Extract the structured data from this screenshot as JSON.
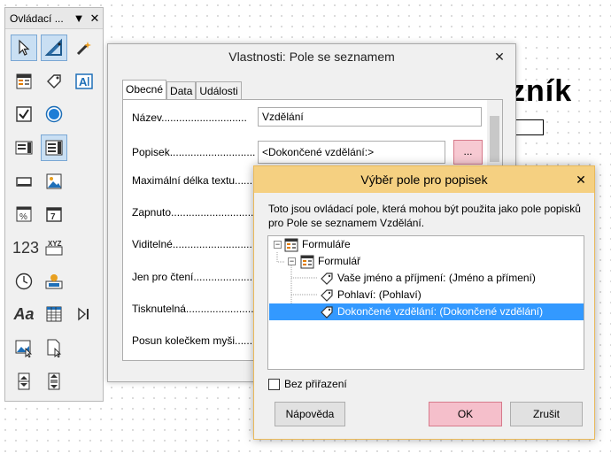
{
  "background": {
    "title_fragment": "zník"
  },
  "toolbox": {
    "title": "Ovládací ...",
    "tools": [
      "select-arrow-icon",
      "design-mode-icon",
      "wizard-wand-icon",
      "form-navigator-icon",
      "label-tag-icon",
      "text-field-icon",
      "checkbox-icon",
      "radio-button-icon",
      "list-box-icon",
      "combo-box-icon",
      "push-button-icon",
      "image-button-icon",
      "formatted-field-icon",
      "date-field-icon",
      "numeric-field-icon",
      "pattern-field-icon",
      "time-field-icon",
      "currency-field-icon",
      "font-aa-icon",
      "table-control-icon",
      "navigation-bar-icon",
      "image-control-icon",
      "file-selection-icon",
      "spin-button-icon",
      "scrollbar-icon"
    ],
    "numeric_label": "123",
    "pattern_label": "XYZ",
    "font_label": "Aa",
    "date_label": "7"
  },
  "properties": {
    "title": "Vlastnosti: Pole se seznamem",
    "close": "✕",
    "tabs": [
      {
        "label": "Obecné"
      },
      {
        "label": "Data"
      },
      {
        "label": "Události"
      }
    ],
    "rows": {
      "name_label": "Název.............................",
      "name_value": "Vzdělání",
      "caption_label": "Popisek.............................",
      "caption_value": "<Dokončené vzdělání:>",
      "caption_button": "...",
      "maxlen_label": "Maximální délka textu.......",
      "enabled_label": "Zapnuto............................",
      "visible_label": "Viditelné...........................",
      "readonly_label": "Jen pro čtení.....................",
      "printable_label": "Tisknutelná.......................",
      "wheel_label": "Posun kolečkem myši.........."
    }
  },
  "dialog": {
    "title": "Výběr pole pro popisek",
    "close": "✕",
    "description": "Toto jsou ovládací pole, která mohou být použita jako pole popisků pro Pole se seznamem Vzdělání.",
    "tree": [
      {
        "label": "Formuláře",
        "icon": "forms-icon",
        "expander": "−"
      },
      {
        "label": "Formulář",
        "icon": "form-icon",
        "expander": "−"
      },
      {
        "label": "Vaše jméno a příjmení: (Jméno a přímení)",
        "icon": "label-tag-icon"
      },
      {
        "label": "Pohlaví: (Pohlaví)",
        "icon": "label-tag-icon"
      },
      {
        "label": "Dokončené vzdělání: (Dokončené vzdělání)",
        "icon": "label-tag-icon",
        "selected": true
      }
    ],
    "no_assignment": "Bez přiřazení",
    "help_button": "Nápověda",
    "ok_button": "OK",
    "cancel_button": "Zrušit"
  }
}
